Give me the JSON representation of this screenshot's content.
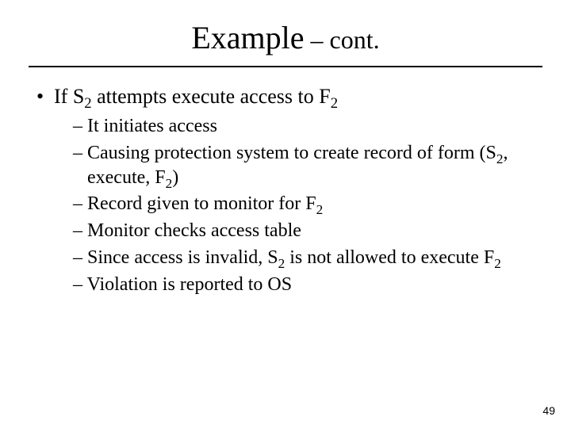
{
  "title": {
    "main": "Example",
    "suffix": " – cont."
  },
  "bullet": {
    "pre": "If S",
    "sub1": "2",
    "mid": " attempts execute access to F",
    "sub2": "2"
  },
  "subs": {
    "s1": "It initiates access",
    "s2a": "Causing protection system to create record of form  (S",
    "s2sub1": "2",
    "s2b": ", execute, F",
    "s2sub2": "2",
    "s2c": ")",
    "s3a": "Record given to monitor for F",
    "s3sub": "2",
    "s4": "Monitor checks access table",
    "s5a": "Since access is invalid, S",
    "s5sub1": "2",
    "s5b": " is not allowed to execute F",
    "s5sub2": "2",
    "s6": "Violation is reported to OS"
  },
  "page": "49"
}
